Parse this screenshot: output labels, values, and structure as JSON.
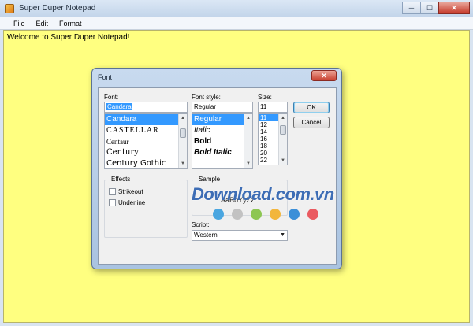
{
  "window": {
    "title": "Super Duper Notepad",
    "icon": "notepad-app-icon"
  },
  "title_buttons": {
    "minimize": "─",
    "maximize": "☐",
    "close": "✕"
  },
  "menu": [
    "File",
    "Edit",
    "Format"
  ],
  "editor": {
    "text": "Welcome to Super Duper Notepad!",
    "background": "#ffff80"
  },
  "dialog": {
    "title": "Font",
    "close": "✕",
    "font_label": "Font:",
    "font_value": "Candara",
    "font_list": [
      "Candara",
      "CASTELLAR",
      "Centaur",
      "Century",
      "Century Gothic"
    ],
    "font_selected": 0,
    "style_label": "Font style:",
    "style_value": "Regular",
    "style_list": [
      "Regular",
      "Italic",
      "Bold",
      "Bold Italic"
    ],
    "style_selected": 0,
    "size_label": "Size:",
    "size_value": "11",
    "size_list": [
      "11",
      "12",
      "14",
      "16",
      "18",
      "20",
      "22"
    ],
    "size_selected": 0,
    "ok": "OK",
    "cancel": "Cancel",
    "effects_title": "Effects",
    "strikeout": "Strikeout",
    "underline": "Underline",
    "sample_title": "Sample",
    "sample_text": "AaBbYyZz",
    "script_label": "Script:",
    "script_value": "Western"
  },
  "watermark": {
    "text": "Download.com.vn",
    "dot_colors": [
      "#4aa6e0",
      "#c2c2c2",
      "#8dc652",
      "#f2b63c",
      "#3b8fd8",
      "#ea5a60"
    ]
  }
}
